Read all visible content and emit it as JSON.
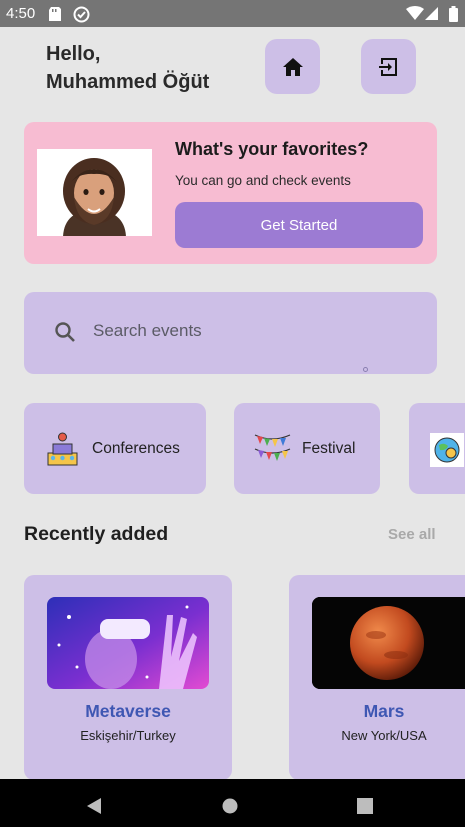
{
  "status_bar": {
    "time": "4:50"
  },
  "greeting": {
    "line1": "Hello,",
    "line2": "Muhammed Öğüt"
  },
  "promo": {
    "title": "What's your favorites?",
    "subtitle": "You can go and check events",
    "button_label": "Get Started"
  },
  "search": {
    "placeholder": "Search events"
  },
  "categories": [
    {
      "label": "Conferences",
      "icon": "conference-icon"
    },
    {
      "label": "Festival",
      "icon": "festival-icon"
    },
    {
      "label": "",
      "icon": "globe-icon"
    }
  ],
  "recent": {
    "title": "Recently added",
    "see_all": "See all",
    "events": [
      {
        "title": "Metaverse",
        "location": "Eskişehir/Turkey"
      },
      {
        "title": "Mars",
        "location": "New York/USA"
      }
    ]
  },
  "colors": {
    "accent": "#9c7bd3",
    "card": "#cdbfe7",
    "promo_bg": "#f7bcd2",
    "event_title": "#3f57b3"
  }
}
